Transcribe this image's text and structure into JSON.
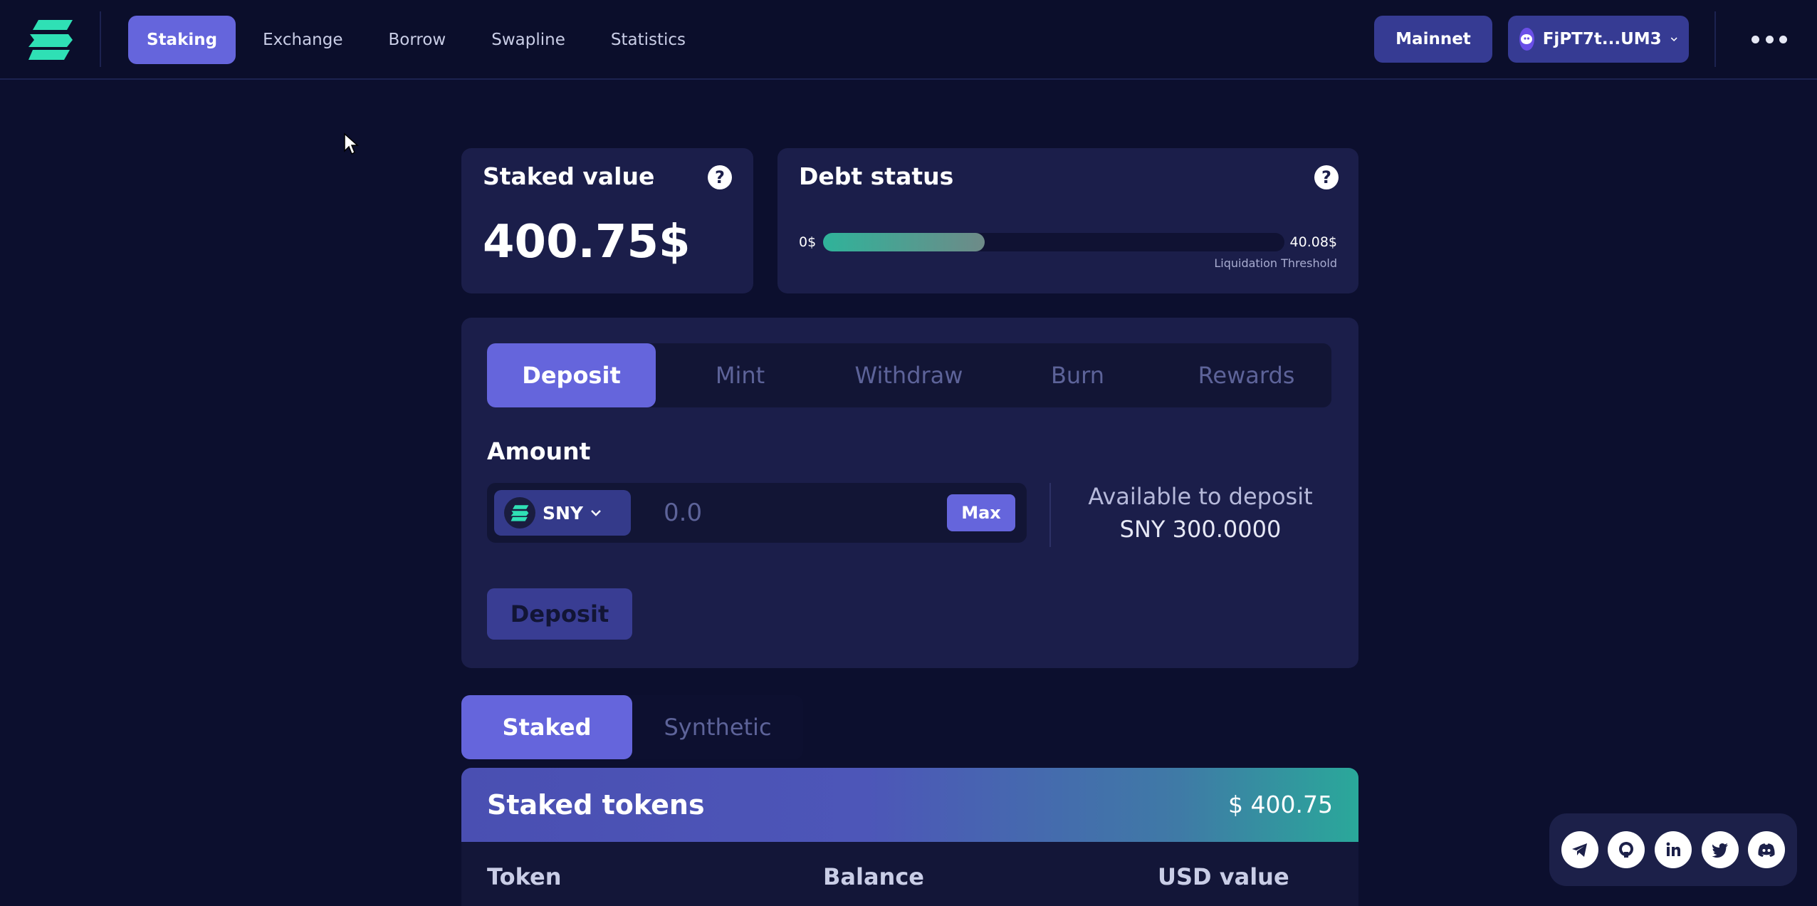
{
  "header": {
    "nav": [
      "Staking",
      "Exchange",
      "Borrow",
      "Swapline",
      "Statistics"
    ],
    "network_label": "Mainnet",
    "wallet_label": "FjPT7t...UM3"
  },
  "staked_card": {
    "title": "Staked value",
    "value": "400.75$"
  },
  "debt_card": {
    "title": "Debt status",
    "min_label": "0$",
    "max_label": "40.08$",
    "threshold_label": "Liquidation Threshold",
    "fill_fraction": 0.35
  },
  "action_card": {
    "tabs": [
      "Deposit",
      "Mint",
      "Withdraw",
      "Burn",
      "Rewards"
    ],
    "active_tab": "Deposit",
    "amount_label": "Amount",
    "token": "SNY",
    "amount_placeholder": "0.0",
    "max_label": "Max",
    "available_label": "Available to deposit",
    "available_value": "SNY 300.0000",
    "submit_label": "Deposit"
  },
  "holdings": {
    "toggle": [
      "Staked",
      "Synthetic"
    ],
    "title": "Staked tokens",
    "total": "$ 400.75",
    "columns": [
      "Token",
      "Balance",
      "USD value"
    ]
  },
  "social": [
    "telegram-icon",
    "github-icon",
    "linkedin-icon",
    "twitter-icon",
    "discord-icon"
  ],
  "colors": {
    "background": "#0c0f2e",
    "card": "#1b1e4a",
    "accent": "#6565dc",
    "teal": "#2fb39a"
  }
}
